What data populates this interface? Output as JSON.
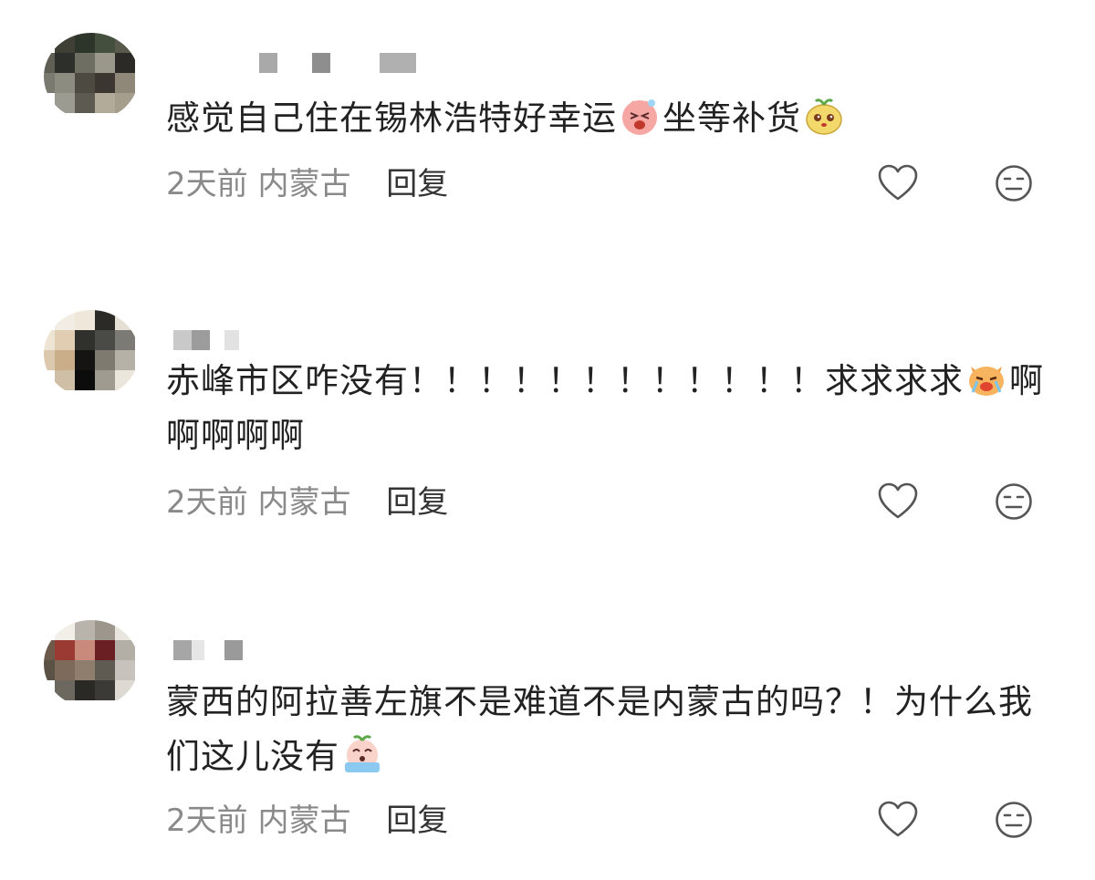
{
  "comments": [
    {
      "text": "感觉自己住在锡林浩特好幸运",
      "emoji1": "sneezing-face-emoji",
      "text2": "坐等补货",
      "emoji2": "melon-face-emoji",
      "time": "2天前",
      "location": "内蒙古",
      "reply": "回复"
    },
    {
      "text": "赤峰市区咋没有！！！！！！！！！！！！求求求求",
      "emoji1": "crying-cat-emoji",
      "text2": "啊啊啊啊啊",
      "time": "2天前",
      "location": "内蒙古",
      "reply": "回复"
    },
    {
      "text": "蒙西的阿拉善左旗不是难道不是内蒙古的吗？！为什么我们这儿没有",
      "emoji1": "crying-face-emoji",
      "time": "2天前",
      "location": "内蒙古",
      "reply": "回复"
    }
  ],
  "icons": {
    "like": "heart-icon",
    "dislike": "neutral-face-icon"
  }
}
